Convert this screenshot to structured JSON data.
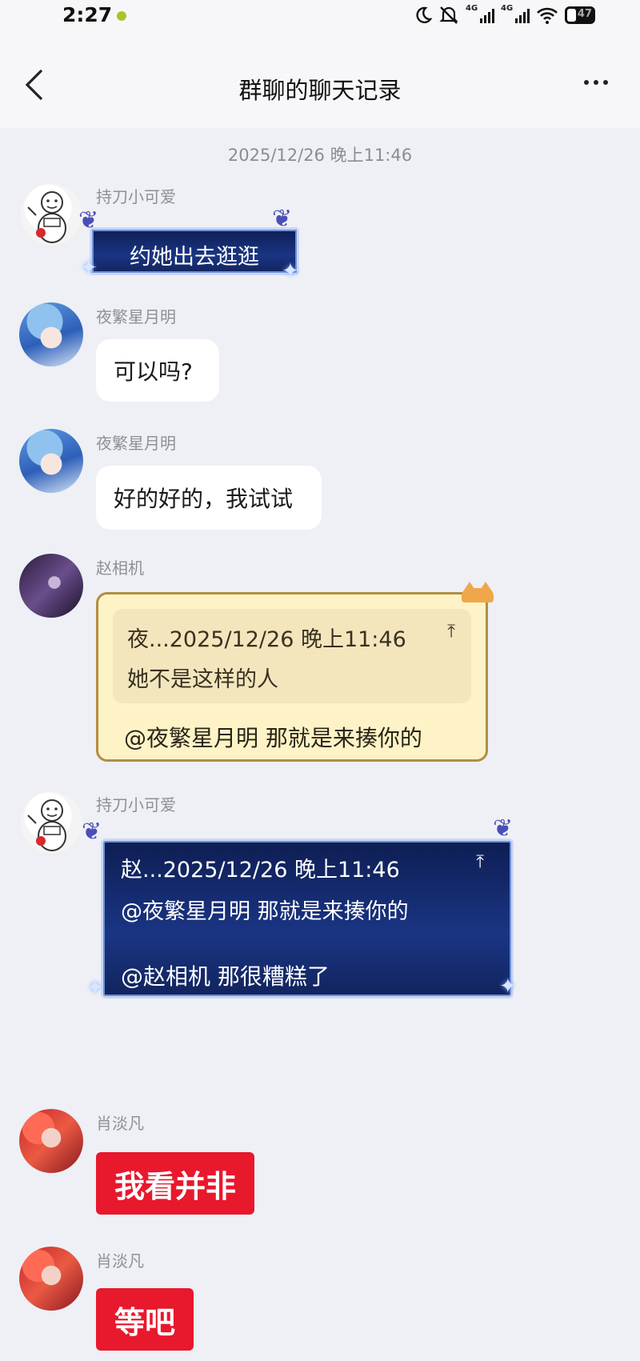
{
  "status_bar": {
    "time": "2:27",
    "network_1": "4G",
    "network_2": "4G",
    "battery": "47"
  },
  "header": {
    "title": "群聊的聊天记录"
  },
  "timestamp": "2025/12/26 晚上11:46",
  "messages": [
    {
      "sender": "持刀小可爱",
      "text": "约她出去逛逛"
    },
    {
      "sender": "夜繁星月明",
      "text": "可以吗?"
    },
    {
      "sender": "夜繁星月明",
      "text": "好的好的，我试试"
    },
    {
      "sender": "赵相机",
      "quote_head": "夜...2025/12/26 晚上11:46",
      "quote_text": "她不是这样的人",
      "text": "@夜繁星月明 那就是来揍你的"
    },
    {
      "sender": "持刀小可爱",
      "quote_head": "赵...2025/12/26 晚上11:46",
      "quote_text": "@夜繁星月明 那就是来揍你的",
      "text": "@赵相机 那很糟糕了"
    },
    {
      "sender": "肖淡凡",
      "text": "我看并非"
    },
    {
      "sender": "肖淡凡",
      "text": "等吧"
    }
  ]
}
